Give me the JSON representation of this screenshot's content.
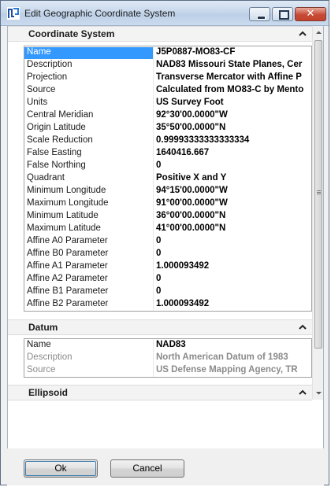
{
  "window": {
    "title": "Edit Geographic Coordinate System",
    "close_glyph": "✕",
    "colors": {
      "selection": "#3399ff",
      "titlebar": "#c8d8ec",
      "close_button": "#c74a36"
    }
  },
  "sections": {
    "coordinate_system": {
      "title": "Coordinate System",
      "rows": [
        {
          "key": "Name",
          "value": "J5P0887-MO83-CF"
        },
        {
          "key": "Description",
          "value": "NAD83 Missouri State Planes, Cer"
        },
        {
          "key": "Projection",
          "value": "Transverse Mercator with Affine P"
        },
        {
          "key": "Source",
          "value": "Calculated from MO83-C by Mento"
        },
        {
          "key": "Units",
          "value": "US Survey Foot"
        },
        {
          "key": "Central Meridian",
          "value": "92°30'00.0000\"W"
        },
        {
          "key": "Origin Latitude",
          "value": "35°50'00.0000\"N"
        },
        {
          "key": "Scale Reduction",
          "value": "0.99993333333333334"
        },
        {
          "key": "False Easting",
          "value": "1640416.667"
        },
        {
          "key": "False Northing",
          "value": "0"
        },
        {
          "key": "Quadrant",
          "value": "Positive X and Y"
        },
        {
          "key": "Minimum Longitude",
          "value": "94°15'00.0000\"W"
        },
        {
          "key": "Maximum Longitude",
          "value": "91°00'00.0000\"W"
        },
        {
          "key": "Minimum Latitude",
          "value": "36°00'00.0000\"N"
        },
        {
          "key": "Maximum Latitude",
          "value": "41°00'00.0000\"N"
        },
        {
          "key": "Affine A0 Parameter",
          "value": "0"
        },
        {
          "key": "Affine B0 Parameter",
          "value": "0"
        },
        {
          "key": "Affine A1 Parameter",
          "value": "1.000093492"
        },
        {
          "key": "Affine A2 Parameter",
          "value": "0"
        },
        {
          "key": "Affine B1 Parameter",
          "value": "0"
        },
        {
          "key": "Affine B2 Parameter",
          "value": "1.000093492"
        }
      ]
    },
    "datum": {
      "title": "Datum",
      "rows": [
        {
          "key": "Name",
          "value": "NAD83"
        },
        {
          "key": "Description",
          "value": "North American Datum of 1983"
        },
        {
          "key": "Source",
          "value": "US Defense Mapping Agency, TR"
        }
      ]
    },
    "ellipsoid": {
      "title": "Ellipsoid"
    }
  },
  "buttons": {
    "ok": "Ok",
    "cancel": "Cancel"
  }
}
